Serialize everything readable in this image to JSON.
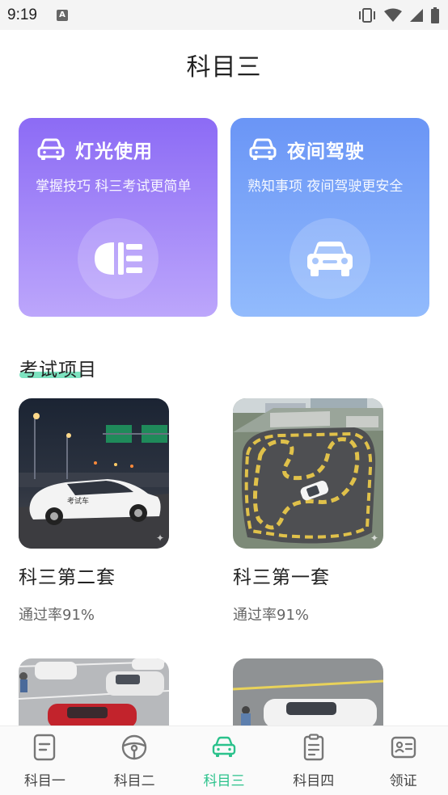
{
  "status_bar": {
    "time": "9:19",
    "notification_letter": "A"
  },
  "page": {
    "title": "科目三"
  },
  "cards": [
    {
      "title": "灯光使用",
      "subtitle": "掌握技巧 科三考试更简单",
      "icon": "headlight-icon"
    },
    {
      "title": "夜间驾驶",
      "subtitle": "熟知事项 夜间驾驶更安全",
      "icon": "car-front-icon"
    }
  ],
  "section": {
    "title": "考试项目"
  },
  "items": [
    {
      "name": "科三第二套",
      "rate": "通过率91%",
      "thumb_text": "考试车"
    },
    {
      "name": "科三第一套",
      "rate": "通过率91%"
    },
    {
      "name": "",
      "rate": ""
    },
    {
      "name": "",
      "rate": ""
    }
  ],
  "tabs": [
    {
      "label": "科目一",
      "icon": "document-icon",
      "active": false
    },
    {
      "label": "科目二",
      "icon": "steering-wheel-icon",
      "active": false
    },
    {
      "label": "科目三",
      "icon": "car-icon",
      "active": true
    },
    {
      "label": "科目四",
      "icon": "clipboard-icon",
      "active": false
    },
    {
      "label": "领证",
      "icon": "id-card-icon",
      "active": false
    }
  ],
  "colors": {
    "accent": "#2bc28c",
    "card_purple": "#8c6bf5",
    "card_blue": "#6a95f6",
    "underline": "#7de3c0"
  }
}
